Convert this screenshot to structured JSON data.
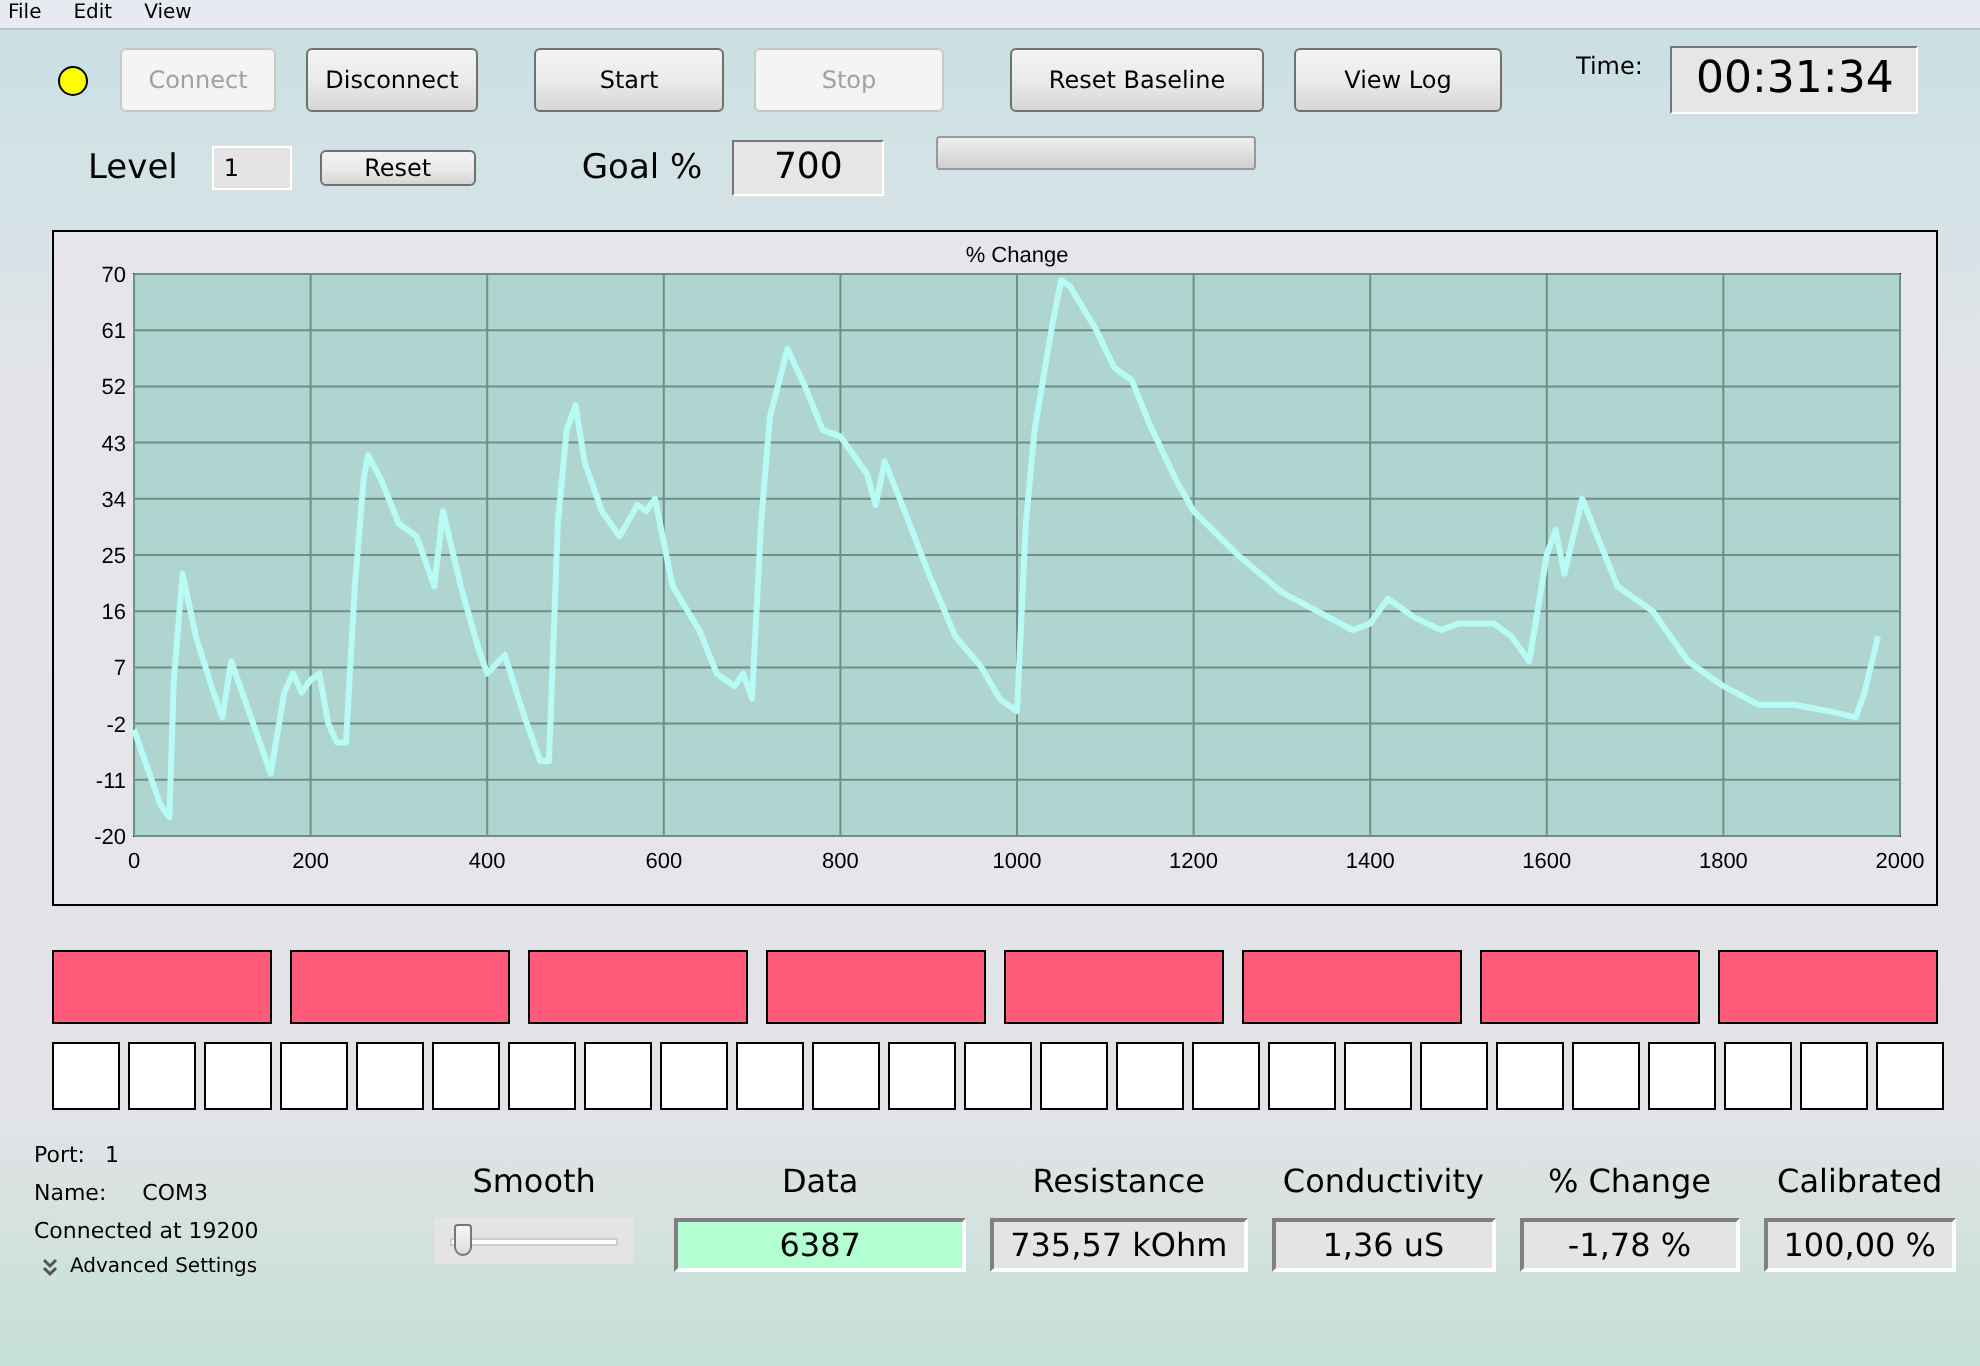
{
  "menu": [
    "File",
    "Edit",
    "View"
  ],
  "indicator": {
    "color": "#ffff00"
  },
  "buttons": [
    {
      "label": "Connect",
      "disabled": true
    },
    {
      "label": "Disconnect",
      "disabled": false
    },
    {
      "label": "Start",
      "disabled": false
    },
    {
      "label": "Stop",
      "disabled": true
    },
    {
      "label": "Reset Baseline",
      "disabled": false
    },
    {
      "label": "View Log",
      "disabled": false
    }
  ],
  "time": {
    "label": "Time:",
    "value": "00:31:34"
  },
  "level": {
    "label": "Level",
    "value": "1",
    "reset": "Reset"
  },
  "goal": {
    "label": "Goal %",
    "value": "700"
  },
  "goal_progress": {
    "level": 0
  },
  "chart": {
    "chart_data": {
      "type": "line",
      "title": "% Change",
      "grid": true,
      "xlim": [
        0,
        2000
      ],
      "ylim": [
        -20,
        70
      ],
      "xticks": [
        0,
        200,
        400,
        600,
        800,
        1000,
        1200,
        1400,
        1600,
        1800,
        2000
      ],
      "yticks": [
        -20,
        -11,
        -2,
        7,
        16,
        25,
        34,
        43,
        52,
        61,
        70
      ],
      "x": [
        0,
        30,
        40,
        45,
        55,
        70,
        90,
        100,
        110,
        120,
        130,
        150,
        155,
        170,
        180,
        190,
        200,
        210,
        220,
        230,
        240,
        250,
        260,
        265,
        280,
        300,
        320,
        340,
        350,
        370,
        390,
        400,
        420,
        440,
        460,
        470,
        480,
        490,
        500,
        510,
        530,
        550,
        570,
        580,
        590,
        610,
        640,
        660,
        680,
        690,
        700,
        710,
        720,
        740,
        760,
        780,
        800,
        830,
        840,
        850,
        870,
        900,
        930,
        960,
        980,
        1000,
        1010,
        1020,
        1040,
        1050,
        1060,
        1090,
        1110,
        1130,
        1150,
        1180,
        1200,
        1250,
        1300,
        1340,
        1380,
        1400,
        1420,
        1450,
        1480,
        1500,
        1540,
        1560,
        1580,
        1600,
        1610,
        1620,
        1640,
        1660,
        1680,
        1720,
        1760,
        1800,
        1840,
        1880,
        1920,
        1950,
        1960,
        1975
      ],
      "series": [
        {
          "color": "#b8fbf4",
          "values": [
            -3,
            -15,
            -17,
            5,
            22,
            12,
            3,
            -1,
            8,
            4,
            0,
            -8,
            -10,
            3,
            6,
            3,
            5,
            6,
            -2,
            -5,
            -5,
            20,
            37,
            41,
            37,
            30,
            28,
            20,
            32,
            20,
            10,
            6,
            9,
            0,
            -8,
            -8,
            30,
            45,
            49,
            40,
            32,
            28,
            33,
            32,
            34,
            20,
            13,
            6,
            4,
            6,
            2,
            30,
            47,
            58,
            52,
            45,
            44,
            38,
            33,
            40,
            33,
            22,
            12,
            7,
            2,
            0,
            30,
            45,
            62,
            69,
            68,
            61,
            55,
            53,
            46,
            37,
            32,
            25,
            19,
            16,
            13,
            14,
            18,
            15,
            13,
            14,
            14,
            12,
            8,
            25,
            29,
            22,
            34,
            27,
            20,
            16,
            8,
            4,
            1,
            1,
            0,
            -1,
            3,
            12
          ]
        }
      ]
    }
  },
  "blocks": [
    {
      "color": "#ff5a7a"
    },
    {
      "color": "#ff5a7a"
    },
    {
      "color": "#ff5a7a"
    },
    {
      "color": "#ff5a7a"
    },
    {
      "color": "#ff5a7a"
    },
    {
      "color": "#ff5a7a"
    },
    {
      "color": "#ff5a7a"
    },
    {
      "color": "#ff5a7a"
    }
  ],
  "squares": [
    {
      "color": "#ffffff"
    },
    {
      "color": "#ffffff"
    },
    {
      "color": "#ffffff"
    },
    {
      "color": "#ffffff"
    },
    {
      "color": "#ffffff"
    },
    {
      "color": "#ffffff"
    },
    {
      "color": "#ffffff"
    },
    {
      "color": "#ffffff"
    },
    {
      "color": "#ffffff"
    },
    {
      "color": "#ffffff"
    },
    {
      "color": "#ffffff"
    },
    {
      "color": "#ffffff"
    },
    {
      "color": "#ffffff"
    },
    {
      "color": "#ffffff"
    },
    {
      "color": "#ffffff"
    },
    {
      "color": "#ffffff"
    },
    {
      "color": "#ffffff"
    },
    {
      "color": "#ffffff"
    },
    {
      "color": "#ffffff"
    },
    {
      "color": "#ffffff"
    },
    {
      "color": "#ffffff"
    },
    {
      "color": "#ffffff"
    },
    {
      "color": "#ffffff"
    },
    {
      "color": "#ffffff"
    },
    {
      "color": "#ffffff"
    }
  ],
  "port": {
    "port_label": "Port:",
    "port_value": "1",
    "name_label": "Name:",
    "name_value": "COM3",
    "status": "Connected at 19200",
    "advanced": "Advanced Settings"
  },
  "smooth": {
    "label": "Smooth",
    "level": 0.05
  },
  "readouts": [
    {
      "label": "Data",
      "value": "6387",
      "highlighted": true
    },
    {
      "label": "Resistance",
      "value": "735,57 kOhm",
      "highlighted": false
    },
    {
      "label": "Conductivity",
      "value": "1,36 uS",
      "highlighted": false
    },
    {
      "label": "% Change",
      "value": "-1,78 %",
      "highlighted": false
    },
    {
      "label": "Calibrated",
      "value": "100,00 %",
      "highlighted": false
    }
  ]
}
